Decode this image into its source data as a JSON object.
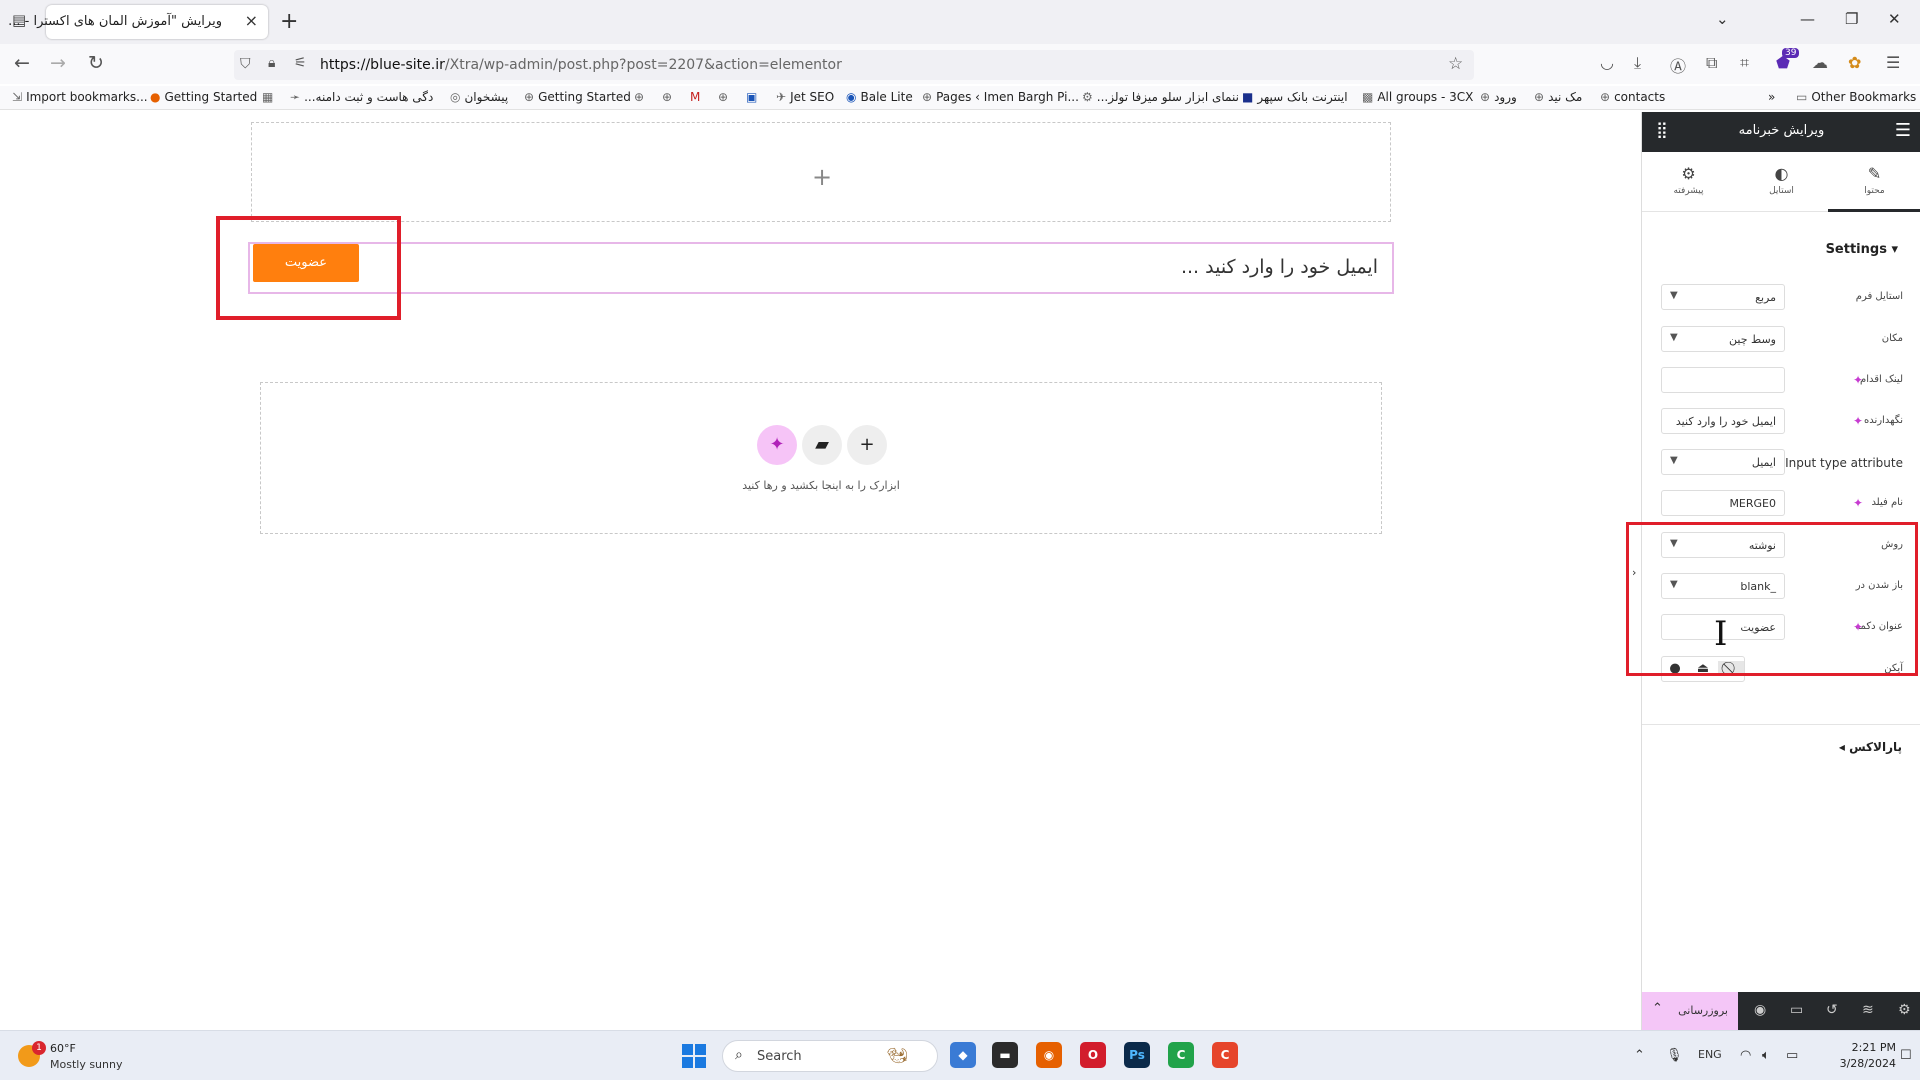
{
  "browser": {
    "tab_title": "ویرایش \"آموزش المان های اکسترا - ...",
    "new_tab": "+",
    "url_host": "https://blue-site.ir",
    "url_path": "/Xtra/wp-admin/post.php?post=2207&action=elementor",
    "extension_badge": "39",
    "bookmarks": [
      "Import bookmarks...",
      "Getting Started",
      "...دگی هاست و ثبت دامنه",
      "پیشخوان",
      "Getting Started",
      "Jet SEO",
      "Bale Lite",
      "Pages ‹ Imen Bargh Pi...",
      "...ننمای ابزار سلو میزفا تولز",
      "اینترنت بانک سپهر",
      "All groups - 3CX",
      "ورود",
      "مک نید",
      "contacts"
    ],
    "other_bookmarks": "Other Bookmarks"
  },
  "canvas": {
    "top_plus": "+",
    "input_placeholder": "ایمیل خود را وارد کنید ...",
    "submit_button": "عضویت",
    "drop_hint": "ابزارک را به اینجا بکشید و رها کنید"
  },
  "panel": {
    "title": "ویرایش خبرنامه",
    "tabs": [
      {
        "label": "محتوا",
        "icon": "pencil-icon"
      },
      {
        "label": "استایل",
        "icon": "contrast-icon"
      },
      {
        "label": "پیشرفته",
        "icon": "gear-icon"
      }
    ],
    "section": "Settings",
    "fields": [
      {
        "label": "استایل فرم",
        "value": "مربع",
        "type": "select"
      },
      {
        "label": "مکان",
        "value": "وسط چین",
        "type": "select"
      },
      {
        "label": "لینک اقدام",
        "value": "",
        "type": "text",
        "ai": true
      },
      {
        "label": "نگهدارنده",
        "value": "ایمیل خود را وارد کنید",
        "type": "text",
        "ai": true
      },
      {
        "label": "Input type attribute",
        "value": "ایمیل",
        "type": "select"
      },
      {
        "label": "نام فیلد",
        "value": "MERGE0",
        "type": "text",
        "ai": true
      },
      {
        "label": "روش",
        "value": "نوشته",
        "type": "select"
      },
      {
        "label": "باز شدن در",
        "value": "_blank",
        "type": "select"
      },
      {
        "label": "عنوان دکمه",
        "value": "عضویت",
        "type": "text",
        "ai": true
      },
      {
        "label": "آیکن",
        "value": "",
        "type": "icons"
      }
    ],
    "parallax": "پارالاکس",
    "publish": "بروزرسانی"
  },
  "taskbar": {
    "notif_count": "1",
    "temp": "60°F",
    "condition": "Mostly sunny",
    "search": "Search",
    "lang": "ENG",
    "time": "2:21 PM",
    "date": "3/28/2024"
  },
  "colors": {
    "accent_orange": "#ff7f0e",
    "highlight_red": "#e01e2a",
    "panel_dark": "#26292c",
    "publish_pink": "#f4c6f7"
  }
}
